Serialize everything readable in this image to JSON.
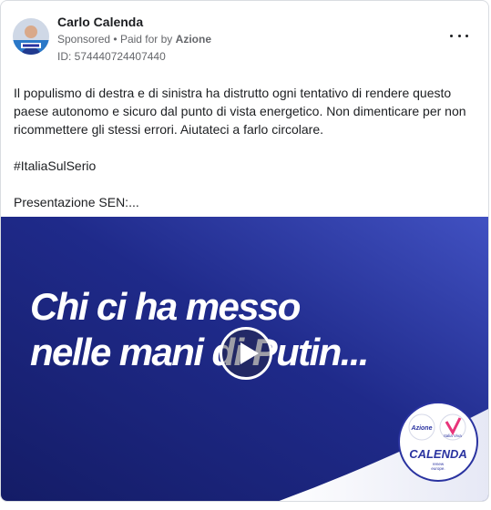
{
  "post": {
    "author": "Carlo Calenda",
    "sponsored": "Sponsored",
    "separator": "•",
    "paid_for_by": "Paid for by",
    "funder": "Azione",
    "ad_id": "ID: 574440724407440",
    "more_icon": "more-horizontal-icon",
    "text": {
      "line1": "Il populismo di destra e di sinistra ha distrutto ogni tentativo di rendere questo paese autonomo e sicuro dal punto di vista energetico. Non dimenticare per non ricommettere gli stessi errori. Aiutateci a farlo circolare.",
      "hashtag": "#ItaliaSulSerio",
      "line3": "Presentazione SEN:..."
    }
  },
  "media": {
    "headline_line1": "Chi ci ha messo",
    "headline_line2": "nelle mani di Putin...",
    "play_icon": "play-icon",
    "badge": {
      "logo_left": "Azione",
      "logo_right": "Italia Viva",
      "name": "CALENDA",
      "sub1": "renew",
      "sub2": "europe."
    },
    "colors": {
      "background_dark": "#1b237a",
      "background_light": "#3a49b8",
      "accent_blue": "#2a33a0",
      "white": "#ffffff"
    }
  }
}
